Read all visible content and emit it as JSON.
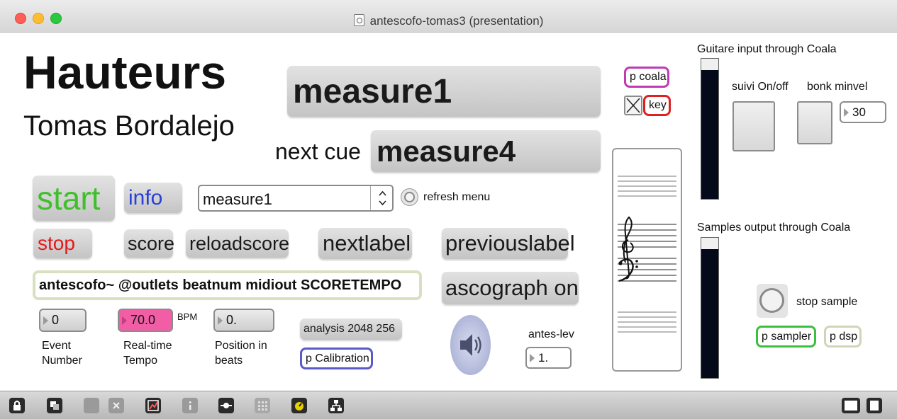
{
  "window": {
    "title": "antescofo-tomas3 (presentation)"
  },
  "header": {
    "title": "Hauteurs",
    "composer": "Tomas Bordalejo"
  },
  "cues": {
    "current": "measure1",
    "next_label": "next cue",
    "next": "measure4"
  },
  "objects": {
    "coala": "p coala",
    "key": "key",
    "antescofo": "antescofo~ @outlets beatnum midiout SCORETEMPO",
    "analysis": "analysis 2048 256",
    "calibration": "p Calibration",
    "sampler": "p sampler",
    "dsp": "p dsp"
  },
  "buttons": {
    "start": "start",
    "info": "info",
    "stop": "stop",
    "score": "score",
    "reloadscore": "reloadscore",
    "nextlabel": "nextlabel",
    "previouslabel": "previouslabel",
    "ascograph": "ascograph on"
  },
  "menu": {
    "selected": "measure1",
    "refresh_label": "refresh menu"
  },
  "numbers": {
    "event": {
      "value": "0",
      "label_line1": "Event",
      "label_line2": "Number"
    },
    "tempo": {
      "value": "70.0",
      "unit": "BPM",
      "label_line1": "Real-time",
      "label_line2": "Tempo"
    },
    "position": {
      "value": "0.",
      "label_line1": "Position in",
      "label_line2": "beats"
    },
    "antes_lev": {
      "label": "antes-lev",
      "value": "1."
    },
    "bonk_minvel": {
      "label": "bonk minvel",
      "value": "30"
    }
  },
  "right_panel": {
    "guitar_label": "Guitare input through Coala",
    "suivi_label": "suivi On/off",
    "samples_label": "Samples output through Coala",
    "stop_sample_label": "stop sample"
  },
  "colors": {
    "start": "#3fbf2a",
    "info": "#2a3fd8",
    "stop": "#e51a1a",
    "coala_border": "#c03ab4",
    "key_border": "#e02020",
    "tempo_bg": "#f25ea6",
    "calibration_border": "#5a5ac8",
    "sampler_border": "#3cbf3c",
    "dsp_border": "#cfd6b8",
    "antescofo_border": "#d9e0c0"
  },
  "toolbar": {
    "icons": [
      "lock-icon",
      "presentation-toggle-icon",
      "hand-icon",
      "delete-icon",
      "debug-icon",
      "info-icon",
      "patch-cord-icon",
      "grid-icon",
      "dsp-icon",
      "hierarchy-icon"
    ],
    "right_icons": [
      "left-sidebar-icon",
      "right-sidebar-icon"
    ]
  }
}
